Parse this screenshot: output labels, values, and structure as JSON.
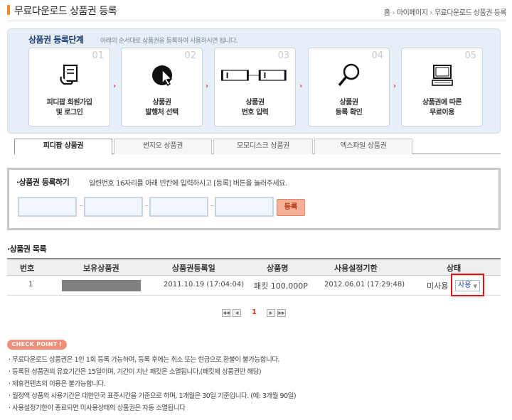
{
  "header": {
    "title": "무료다운로드 상품권 등록",
    "breadcrumb": [
      "홈",
      "마이페이지",
      "무료다운로드 상품권 등록"
    ]
  },
  "steps": {
    "title": "상품권 등록단계",
    "description": "아래의 순서대로 상품권을 등록하여 사용하시면 됩니다.",
    "items": [
      {
        "num": "01",
        "label": "피디팝 회원가입\n및 로그인",
        "icon": "document-hand-icon"
      },
      {
        "num": "02",
        "label": "상품권\n발행처 선택",
        "icon": "cursor-click-icon"
      },
      {
        "num": "03",
        "label": "상품권\n번호 입력",
        "icon": "input-boxes-icon"
      },
      {
        "num": "04",
        "label": "상품권\n등록 확인",
        "icon": "magnifier-icon"
      },
      {
        "num": "05",
        "label": "상품권에 따른\n무료이용",
        "icon": "computer-icon"
      }
    ]
  },
  "tabs": [
    "피디팝 상품권",
    "썬지오 상품권",
    "모모디스크 상품권",
    "엑스파일 상품권"
  ],
  "register": {
    "title": "·상품권 등록하기",
    "description": "일련번호 16자리를 아래 빈칸에 입력하시고 [등록] 버튼을 눌러주세요.",
    "button": "등록"
  },
  "list": {
    "title": "·상품권 목록",
    "columns": [
      "번호",
      "보유상품권",
      "상품권등록일",
      "상품명",
      "사용설정기한",
      "상태"
    ],
    "rows": [
      {
        "no": "1",
        "registered": "2011.10.19 (17:04:04)",
        "product": "패킷 100,000P",
        "expires": "2012.06.01 (17:29:48)",
        "status": "미사용",
        "action": "사용"
      }
    ]
  },
  "pagination": {
    "current": "1"
  },
  "checkpoint": {
    "label": "CHECK POINT !",
    "notes": [
      "· 무료다운로드 상품권은 1인 1회 등록 가능하며, 등록 후에는 취소 또는 현금으로 환불이 불가능합니다.",
      "· 등록된 상품권의 유효기간은 15일이며, 기간이 지난 패킷은 소멸됩니다.(패킷제 상품권만 해당)",
      "· 제휴컨텐츠의 이용은 불가능합니다.",
      "· 월정액 상품의 사용기간은 대한민국 표준시간을 기준으로 하며, 1개월은 30일 기준입니다. (예: 3개월 90일)",
      "· 사용설정기한이 종료되면 미사용상태의 상품권은 자동 소멸됩니다"
    ]
  }
}
